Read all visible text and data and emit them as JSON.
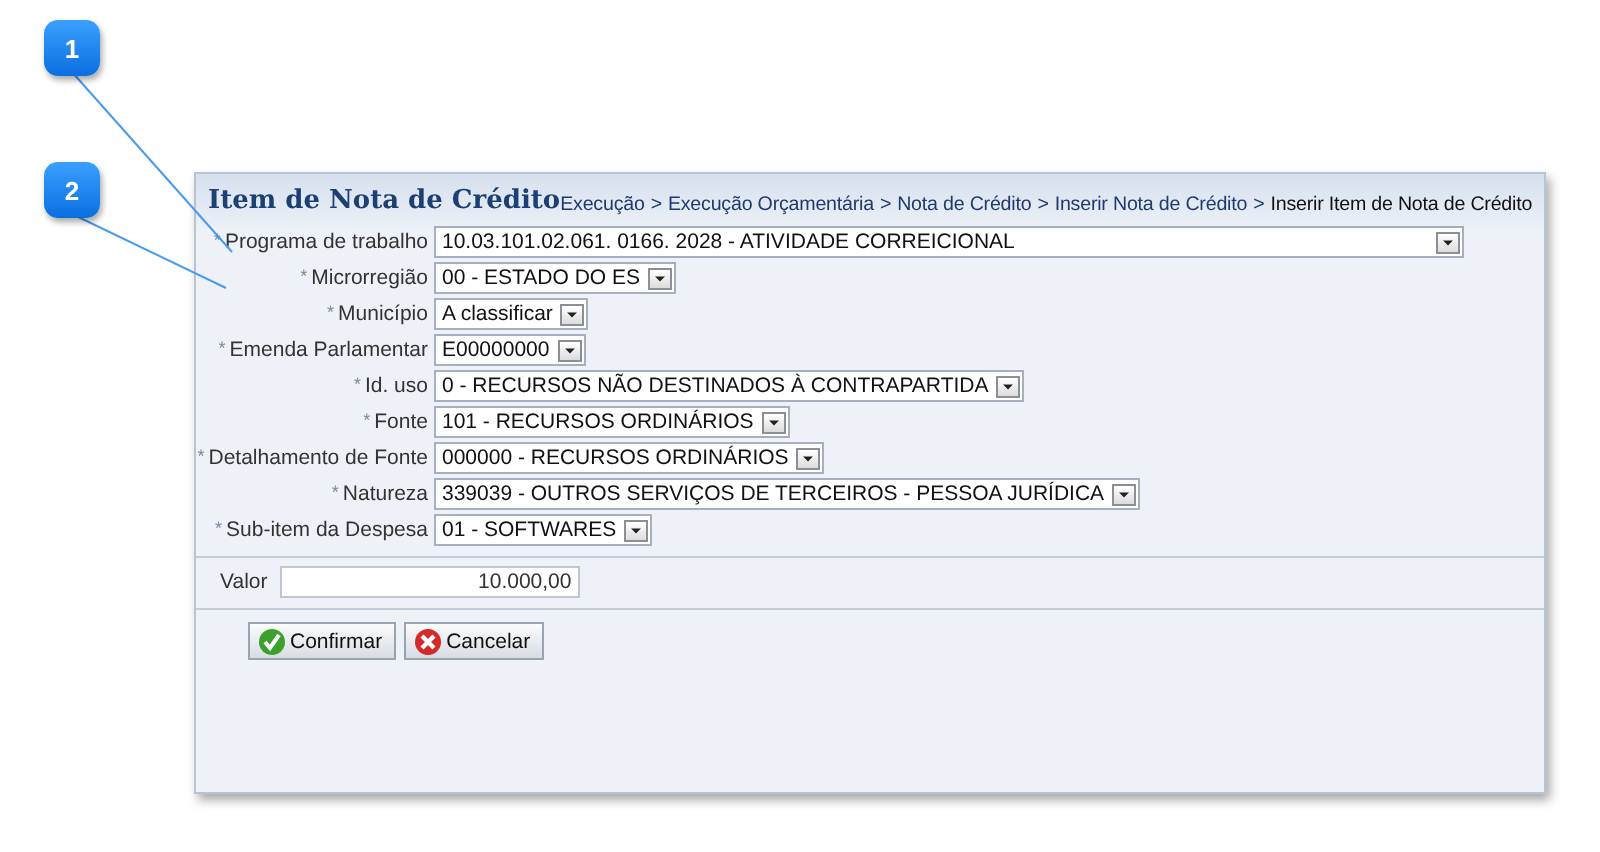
{
  "callouts": [
    "1",
    "2"
  ],
  "panel": {
    "title": "Item de Nota de Crédito",
    "breadcrumb": [
      {
        "label": "Execução"
      },
      {
        "separator": ">",
        "label": "Execução Orçamentária"
      },
      {
        "separator": ">",
        "label": "Nota de Crédito"
      },
      {
        "separator": ">",
        "label": "Inserir Nota de Crédito"
      },
      {
        "separator": ">",
        "label": "Inserir Item de Nota de Crédito"
      }
    ],
    "fields": [
      {
        "required": "*",
        "label": "Programa de trabalho",
        "value": "10.03.101.02.061. 0166. 2028 - ATIVIDADE CORREICIONAL"
      },
      {
        "required": "*",
        "label": "Microrregião",
        "value": "00 - ESTADO DO ES"
      },
      {
        "required": "*",
        "label": "Município",
        "value": "A classificar"
      },
      {
        "required": "*",
        "label": "Emenda Parlamentar",
        "value": "E00000000"
      },
      {
        "required": "*",
        "label": "Id. uso",
        "value": "0 - RECURSOS NÃO DESTINADOS À CONTRAPARTIDA"
      },
      {
        "required": "*",
        "label": "Fonte",
        "value": "101 - RECURSOS ORDINÁRIOS"
      },
      {
        "required": "*",
        "label": "Detalhamento de Fonte",
        "value": "000000 - RECURSOS ORDINÁRIOS"
      },
      {
        "required": "*",
        "label": "Natureza",
        "value": "339039 - OUTROS SERVIÇOS DE TERCEIROS - PESSOA JURÍDICA"
      },
      {
        "required": "*",
        "label": "Sub-item da Despesa",
        "value": "01 - SOFTWARES"
      }
    ],
    "valor": {
      "label": "Valor",
      "value": "10.000,00"
    },
    "buttons": [
      {
        "label": "Confirmar",
        "kind": "confirm"
      },
      {
        "label": "Cancelar",
        "kind": "cancel"
      }
    ]
  }
}
